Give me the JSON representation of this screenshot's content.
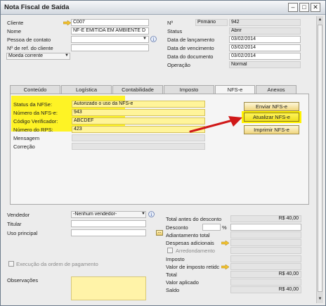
{
  "window": {
    "title": "Nota Fiscal de Saída",
    "controls": {
      "minimize": "–",
      "maximize": "□",
      "close": "✕"
    }
  },
  "header_left": {
    "cliente_label": "Cliente",
    "cliente_value": "C007",
    "nome_label": "Nome",
    "nome_value": "NF-E EMITIDA EM AMBIENTE D",
    "pessoa_label": "Pessoa de contato",
    "pessoa_value": "",
    "ref_label": "Nº de ref. do cliente",
    "ref_value": "",
    "moeda_label": "Moeda corrente"
  },
  "header_right": {
    "no_label": "Nº",
    "serie_value": "Primário",
    "no_value": "942",
    "status_label": "Status",
    "status_value": "Abrir",
    "lancamento_label": "Data de lançamento",
    "lancamento_value": "03/02/2014",
    "vencimento_label": "Data de vencimento",
    "vencimento_value": "03/02/2014",
    "documento_label": "Data do documento",
    "documento_value": "03/02/2014",
    "operacao_label": "Operação",
    "operacao_value": "Normal"
  },
  "tabs": [
    {
      "label": "Conteúdo"
    },
    {
      "label": "Logística"
    },
    {
      "label": "Contabilidade"
    },
    {
      "label": "Imposto"
    },
    {
      "label": "NFS-e"
    },
    {
      "label": "Anexos"
    }
  ],
  "nfse": {
    "status_label": "Status da NFSe:",
    "status_value": "Autorizado o uso da NFS-e",
    "numero_label": "Número da NFS-e:",
    "numero_value": "943",
    "codigo_label": "Código Verificador:",
    "codigo_value": "ABCDEF",
    "rps_label": "Número do RPS:",
    "rps_value": "423",
    "mensagem_label": "Mensagem",
    "correcao_label": "Correção",
    "btn_enviar": "Enviar NFS-e",
    "btn_atualizar": "Atualizar NFS-e",
    "btn_imprimir": "Imprimir NFS-e"
  },
  "footer_left": {
    "vendedor_label": "Vendedor",
    "vendedor_value": "-Nenhum vendedor-",
    "titular_label": "Titular",
    "uso_label": "Uso principal",
    "execucao_label": "Execução da ordem de pagamento",
    "observacoes_label": "Observações"
  },
  "totals": {
    "total_antes_label": "Total antes do desconto",
    "total_antes_value": "R$ 40,00",
    "desconto_label": "Desconto",
    "percent": "%",
    "adiantamento_label": "Adiantamento total",
    "despesas_label": "Despesas adicionais",
    "arredondamento_label": "Arredondamento",
    "imposto_label": "Imposto",
    "valor_imposto_label": "Valor de imposto retidc",
    "total_label": "Total",
    "total_value": "R$ 40,00",
    "valor_aplicado_label": "Valor aplicado",
    "saldo_label": "Saldo",
    "saldo_value": "R$ 40,00"
  },
  "icons": {
    "link_arrow": "link-arrow-icon",
    "dropdown": "▼",
    "info": "i",
    "ellipsis": "..."
  },
  "colors": {
    "highlight": "#fff200",
    "sap_button": "#f0d57e",
    "red_arrow": "#d01818"
  }
}
